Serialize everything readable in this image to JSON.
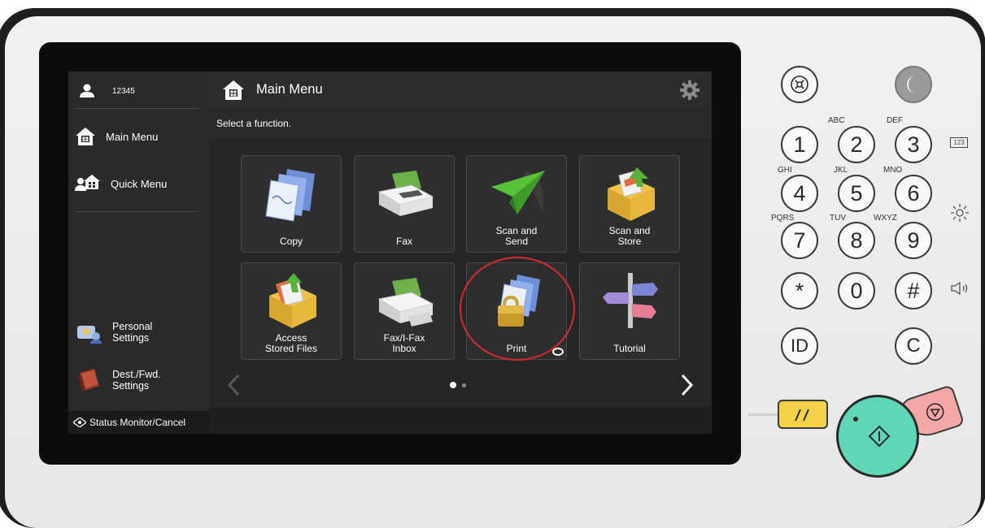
{
  "user": {
    "id": "12345"
  },
  "sidebar": {
    "items": [
      {
        "label": "Main Menu"
      },
      {
        "label": "Quick Menu"
      }
    ],
    "bottom_items": [
      {
        "label": "Personal\nSettings"
      },
      {
        "label": "Dest./Fwd.\nSettings"
      }
    ],
    "status": "Status Monitor/Cancel"
  },
  "header": {
    "title": "Main Menu",
    "instruction": "Select a function."
  },
  "tiles": [
    {
      "label": "Copy",
      "icon": "copy-icon"
    },
    {
      "label": "Fax",
      "icon": "fax-icon"
    },
    {
      "label": "Scan and\nSend",
      "icon": "scan-send-icon"
    },
    {
      "label": "Scan and\nStore",
      "icon": "scan-store-icon"
    },
    {
      "label": "Access\nStored Files",
      "icon": "access-stored-files-icon"
    },
    {
      "label": "Fax/I-Fax\nInbox",
      "icon": "fax-inbox-icon"
    },
    {
      "label": "Print",
      "icon": "print-icon"
    },
    {
      "label": "Tutorial",
      "icon": "tutorial-icon"
    }
  ],
  "pagination": {
    "current": 1,
    "total": 2
  },
  "keypad": {
    "keys": [
      "1",
      "2",
      "3",
      "4",
      "5",
      "6",
      "7",
      "8",
      "9",
      "*",
      "0",
      "#"
    ],
    "letters": [
      "ABC",
      "DEF",
      "GHI",
      "JKL",
      "MNO",
      "PQRS",
      "TUV",
      "WXYZ"
    ],
    "id_key": "ID",
    "clear_key": "C",
    "counter_label": "123"
  },
  "colors": {
    "start": "#5ed6b7",
    "stop": "#f5a7a8",
    "reset": "#f3d24a",
    "highlight_circle": "#d42a2a"
  }
}
